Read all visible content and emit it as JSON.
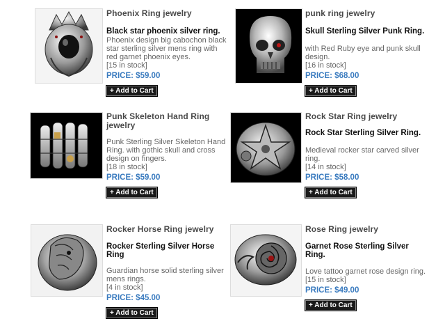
{
  "products": [
    {
      "category_title": "Phoenix Ring jewelry",
      "name": "Black star phoenix silver ring.",
      "description": "Phoenix design big cabochon black star sterling silver mens ring with red garnet phoenix eyes.",
      "stock": "[15 in stock]",
      "price": "PRICE: $59.00",
      "button_label": "+ Add to Cart",
      "image_bg": "#f4f4f4"
    },
    {
      "category_title": "punk ring jewelry",
      "name": "Skull Sterling Silver Punk Ring.",
      "description": "with Red Ruby eye and punk skull design.",
      "stock": "[16 in stock]",
      "price": "PRICE: $68.00",
      "button_label": "+ Add to Cart",
      "image_bg": "#000000"
    },
    {
      "category_title": "Punk Skeleton Hand Ring jewelry",
      "name": "",
      "description": "Punk Sterling Silver Skeleton Hand Ring. with gothic skull and cross design on fingers.",
      "stock": "[18 in stock]",
      "price": "PRICE: $59.00",
      "button_label": "+ Add to Cart",
      "image_bg": "#000000"
    },
    {
      "category_title": "Rock Star Ring jewelry",
      "name": "Rock Star Sterling Silver Ring.",
      "description": "Medieval rocker star carved silver ring.",
      "stock": "[14 in stock]",
      "price": "PRICE: $58.00",
      "button_label": "+ Add to Cart",
      "image_bg": "#000000"
    },
    {
      "category_title": "Rocker Horse Ring jewelry",
      "name": "Rocker Sterling Silver Horse Ring",
      "description": "Guardian horse solid sterling silver mens rings.",
      "stock": "[4 in stock]",
      "price": "PRICE: $45.00",
      "button_label": "+ Add to Cart",
      "image_bg": "#f2f2f2"
    },
    {
      "category_title": "Rose Ring jewelry",
      "name": "Garnet Rose Sterling Silver Ring.",
      "description": "Love tattoo garnet rose design ring.",
      "stock": "[15 in stock]",
      "price": "PRICE: $49.00",
      "button_label": "+ Add to Cart",
      "image_bg": "#f4f4f4"
    }
  ],
  "colors": {
    "price": "#3a7bbf",
    "title": "#4a4a4a",
    "button_bg": "#1a1a1a"
  }
}
